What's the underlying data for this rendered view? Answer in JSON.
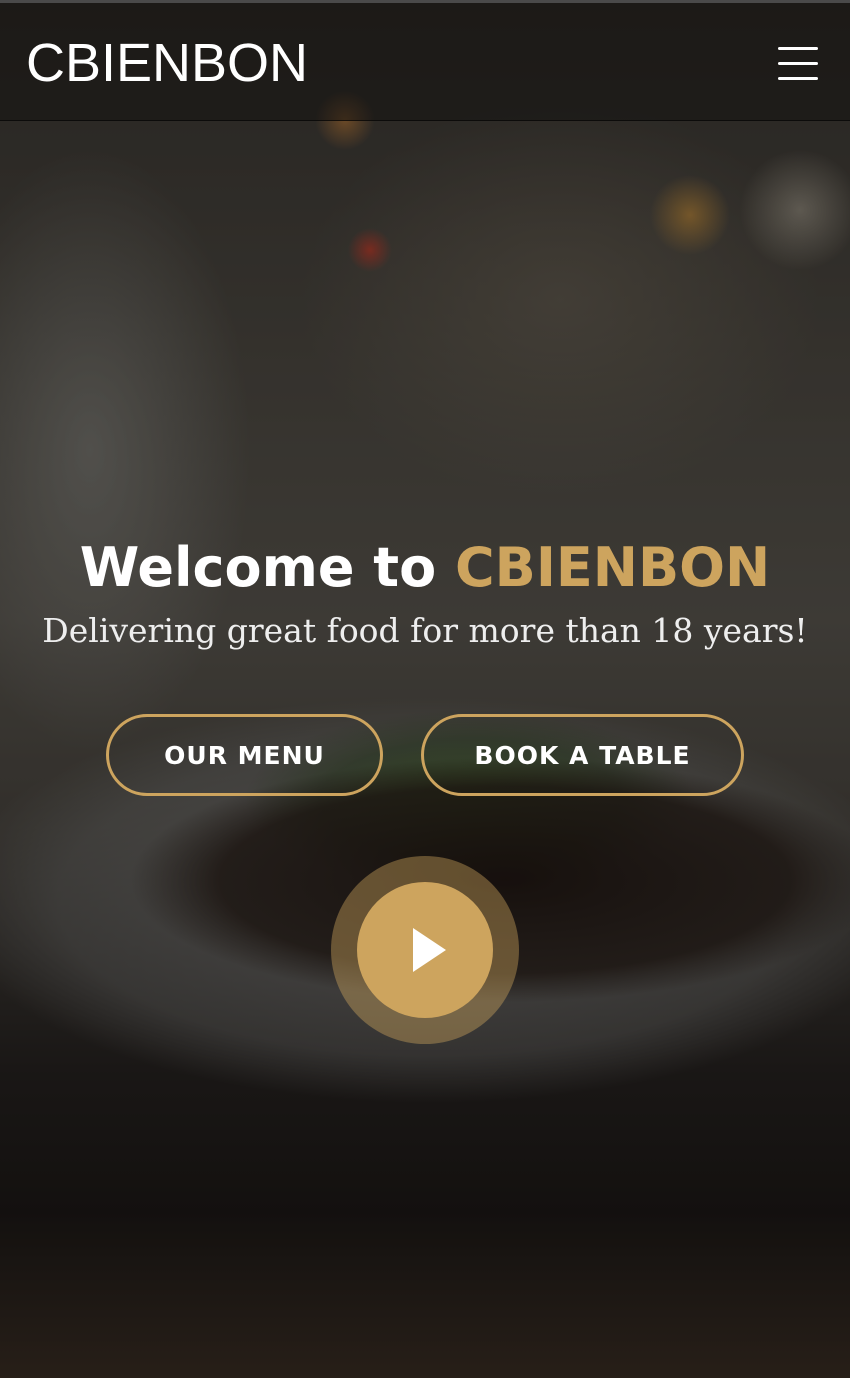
{
  "header": {
    "logo": "CBIENBON",
    "menu_icon": "hamburger-menu-icon"
  },
  "hero": {
    "title_prefix": "Welcome to",
    "title_brand": "CBIENBON",
    "subtitle": "Delivering great food for more than 18 years!",
    "buttons": {
      "menu_label": "OUR MENU",
      "book_label": "BOOK A TABLE"
    },
    "play_icon": "play-icon"
  },
  "colors": {
    "accent": "#cda45e",
    "text": "#ffffff"
  }
}
